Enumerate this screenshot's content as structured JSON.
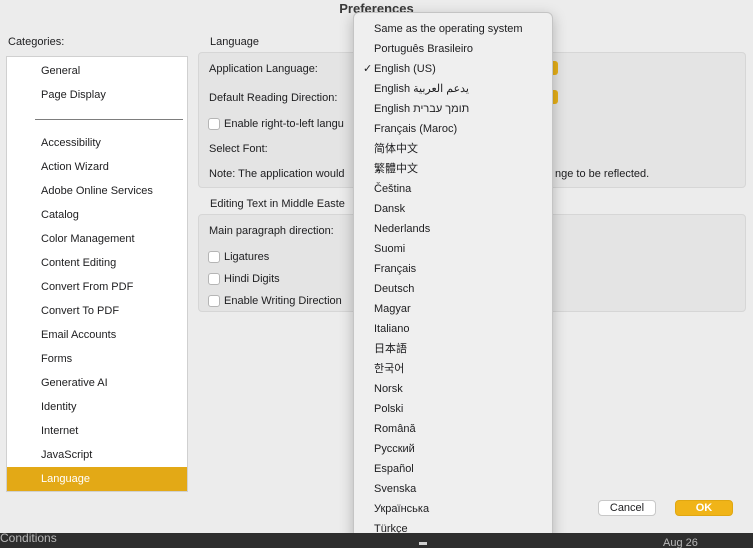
{
  "window": {
    "title": "Preferences"
  },
  "categories": {
    "label": "Categories:",
    "top_items": [
      "General",
      "Page Display"
    ],
    "items": [
      "Accessibility",
      "Action Wizard",
      "Adobe Online Services",
      "Catalog",
      "Color Management",
      "Content Editing",
      "Convert From PDF",
      "Convert To PDF",
      "Email Accounts",
      "Forms",
      "Generative AI",
      "Identity",
      "Internet",
      "JavaScript",
      "Language"
    ],
    "selected": "Language"
  },
  "language_group": {
    "title": "Language",
    "application_language_label": "Application Language:",
    "default_reading_direction_label": "Default Reading Direction:",
    "rtl_checkbox_label": "Enable right-to-left langu",
    "select_font_label": "Select Font:",
    "note_left": "Note: The application would",
    "note_right": "nge to be reflected."
  },
  "middle_east_group": {
    "title": "Editing Text in Middle Easte",
    "paragraph_direction_label": "Main paragraph direction:",
    "ligatures_label": "Ligatures",
    "hindi_digits_label": "Hindi Digits",
    "writing_direction_label": "Enable Writing Direction"
  },
  "language_menu": {
    "checked": "English (US)",
    "checkmark": "✓",
    "options": [
      "Same as the operating system",
      "Português Brasileiro",
      "English (US)",
      "English يدعم العربية",
      "English תומך עברית",
      "Français (Maroc)",
      "简体中文",
      "繁體中文",
      "Čeština",
      "Dansk",
      "Nederlands",
      "Suomi",
      "Français",
      "Deutsch",
      "Magyar",
      "Italiano",
      "日本語",
      "한국어",
      "Norsk",
      "Polski",
      "Română",
      "Русский",
      "Español",
      "Svenska",
      "Українська",
      "Türkçe"
    ]
  },
  "buttons": {
    "cancel": "Cancel",
    "ok": "OK"
  },
  "taskbar": {
    "left": "Conditions",
    "right": "Aug 26"
  },
  "colors": {
    "accent": "#e3a916",
    "ok_button": "#f0b418"
  }
}
